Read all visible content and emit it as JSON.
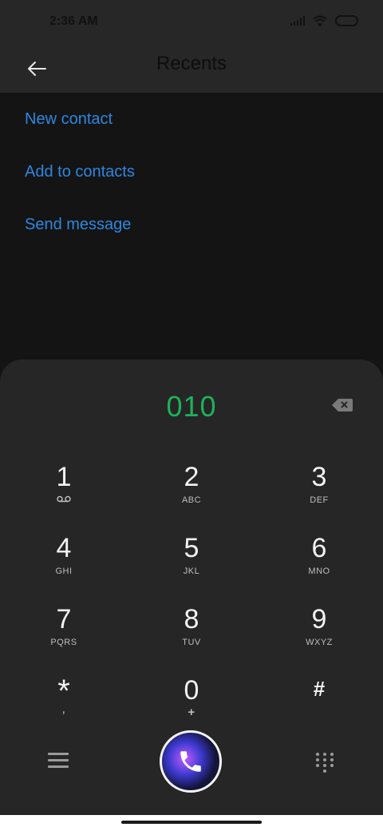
{
  "status_bar": {
    "time": "2:36 AM"
  },
  "header": {
    "title": "Recents"
  },
  "actions": [
    {
      "label": "New contact"
    },
    {
      "label": "Add to contacts"
    },
    {
      "label": "Send message"
    }
  ],
  "dialer": {
    "number": "010",
    "keys": [
      {
        "digit": "1",
        "sub": ""
      },
      {
        "digit": "2",
        "sub": "ABC"
      },
      {
        "digit": "3",
        "sub": "DEF"
      },
      {
        "digit": "4",
        "sub": "GHI"
      },
      {
        "digit": "5",
        "sub": "JKL"
      },
      {
        "digit": "6",
        "sub": "MNO"
      },
      {
        "digit": "7",
        "sub": "PQRS"
      },
      {
        "digit": "8",
        "sub": "TUV"
      },
      {
        "digit": "9",
        "sub": "WXYZ"
      },
      {
        "digit": "*",
        "sub": ","
      },
      {
        "digit": "0",
        "sub": "+"
      },
      {
        "digit": "#",
        "sub": ""
      }
    ]
  },
  "colors": {
    "accent_blue": "#2d87e0",
    "number_green": "#1fb25a"
  },
  "icons": [
    "back-arrow-icon",
    "backspace-icon",
    "voicemail-icon",
    "menu-icon",
    "phone-icon",
    "dialpad-grid-icon",
    "signal-icon",
    "wifi-icon",
    "battery-icon"
  ]
}
